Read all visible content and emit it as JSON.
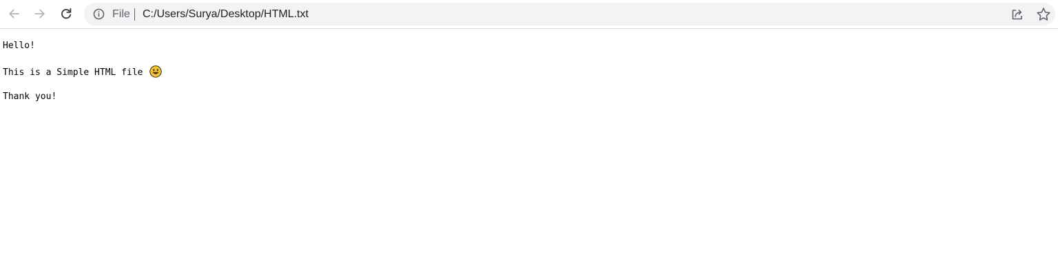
{
  "toolbar": {
    "back_icon": "back-arrow-icon",
    "forward_icon": "forward-arrow-icon",
    "reload_icon": "reload-icon"
  },
  "address_bar": {
    "info_icon": "info-icon",
    "scheme_label": "File",
    "url": "C:/Users/Surya/Desktop/HTML.txt",
    "share_icon": "share-icon",
    "bookmark_icon": "star-icon"
  },
  "document": {
    "lines": [
      "Hello!",
      "This is a Simple HTML file",
      "Thank you!"
    ],
    "emoji_icon": "grinning-face-emoji"
  },
  "colors": {
    "omnibox_bg": "#f1f3f4",
    "icon_gray": "#5f6368",
    "emoji_yellow": "#f7c325"
  }
}
